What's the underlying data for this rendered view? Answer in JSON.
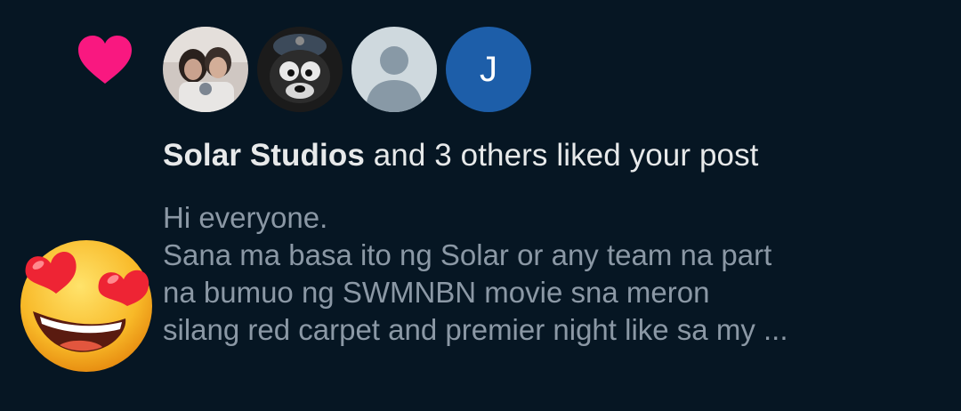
{
  "notification": {
    "icon": "heart-icon",
    "accent_color": "#f91880",
    "avatars": [
      {
        "name": "couple-photo-avatar",
        "initial": ""
      },
      {
        "name": "cartoon-character-avatar",
        "initial": ""
      },
      {
        "name": "default-profile-avatar",
        "initial": ""
      },
      {
        "name": "initial-j-avatar",
        "initial": "J",
        "color": "#1d5ea9"
      }
    ],
    "actor_name": "Solar Studios",
    "action_text": " and 3 others liked your post",
    "post_lines": [
      "Hi everyone.",
      "Sana ma basa ito ng Solar or any team na part",
      "na bumuo ng SWMNBN movie sna meron",
      "silang red carpet and premier night like sa my ..."
    ],
    "emoji": "heart-eyes-emoji"
  }
}
